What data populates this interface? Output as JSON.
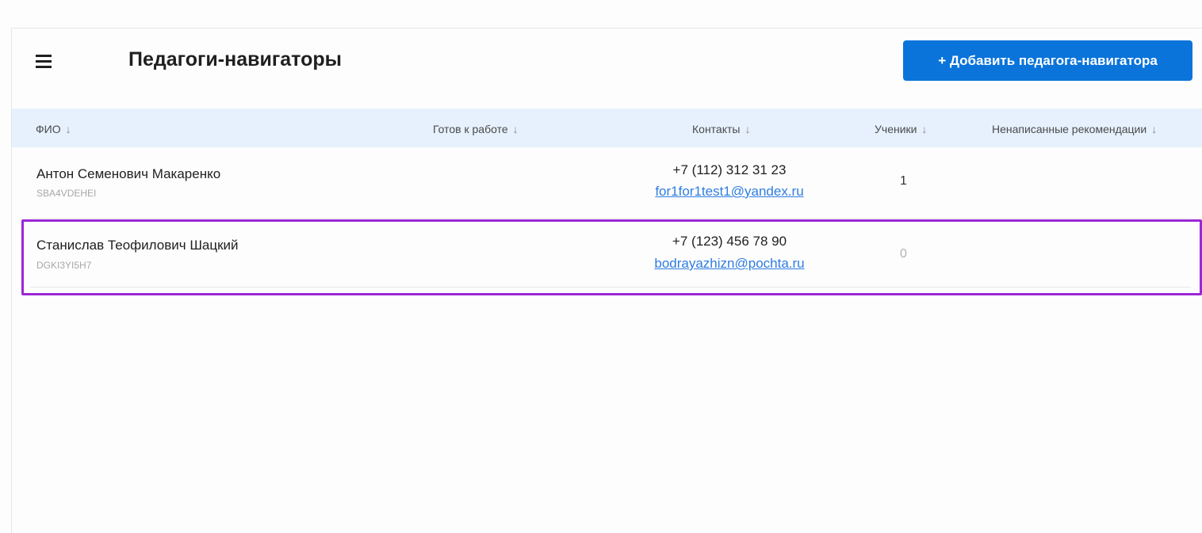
{
  "header": {
    "title": "Педагоги-навигаторы",
    "menu_icon": "hamburger-menu-icon",
    "add_button_label": "+ Добавить педагога-навигатора"
  },
  "table": {
    "columns": [
      {
        "label": "ФИО",
        "sort_icon": "arrow-down-icon"
      },
      {
        "label": "Готов к работе",
        "sort_icon": "arrow-down-icon"
      },
      {
        "label": "Контакты",
        "sort_icon": "arrow-down-icon"
      },
      {
        "label": "Ученики",
        "sort_icon": "arrow-down-icon"
      },
      {
        "label": "Ненаписанные рекомендации",
        "sort_icon": "arrow-down-icon"
      }
    ],
    "rows": [
      {
        "name": "Антон Семенович Макаренко",
        "code": "SBA4VDEHEI",
        "phone": "+7 (112) 312 31 23",
        "email": "for1for1test1@yandex.ru",
        "students": "1"
      },
      {
        "name": "Станислав Теофилович Шацкий",
        "code": "DGKI3YI5H7",
        "phone": "+7 (123) 456 78 90",
        "email": "bodrayazhizn@pochta.ru",
        "students": "0"
      }
    ]
  },
  "colors": {
    "accent": "#0a74da",
    "header_bg": "#e6f1fd",
    "highlight_border": "#9b27d6",
    "link": "#2f7de1"
  }
}
